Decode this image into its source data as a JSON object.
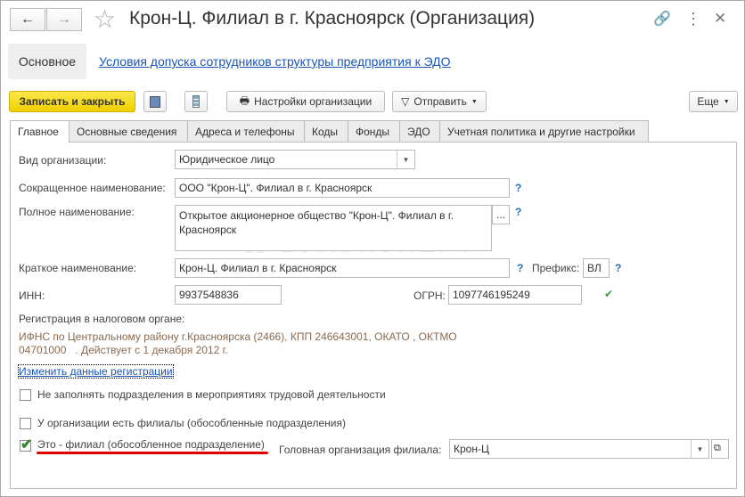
{
  "window": {
    "title": "Крон-Ц. Филиал в г. Красноярск (Организация)"
  },
  "nav": {
    "back": "←",
    "forward": "→",
    "star": "☆",
    "link": "🔗",
    "more": "⋮",
    "close": "✕"
  },
  "sections": {
    "main": "Основное",
    "link": "Условия допуска сотрудников структуры предприятия к ЭДО"
  },
  "toolbar": {
    "save_close": "Записать и закрыть",
    "settings": "Настройки организации",
    "send": "Отправить",
    "more": "Еще"
  },
  "tabs": [
    "Главное",
    "Основные сведения",
    "Адреса и телефоны",
    "Коды",
    "Фонды",
    "ЭДО",
    "Учетная политика и другие настройки"
  ],
  "form": {
    "org_type_label": "Вид организации:",
    "org_type": "Юридическое лицо",
    "short_name_label": "Сокращенное наименование:",
    "short_name": "ООО \"Крон-Ц\". Филиал в г. Красноярск",
    "full_name_label": "Полное наименование:",
    "full_name": "Открытое акционерное общество \"Крон-Ц\". Филиал в г. Красноярск",
    "brief_name_label": "Краткое наименование:",
    "brief_name": "Крон-Ц. Филиал в г. Красноярск",
    "prefix_label": "Префикс:",
    "prefix": "ВЛ",
    "inn_label": "ИНН:",
    "inn": "9937548836",
    "ogrn_label": "ОГРН:",
    "ogrn": "1097746195249",
    "reg_label": "Регистрация в налоговом органе:",
    "reg_line1": "ИФНС по Центральному району г.Красноярска (2466), КПП 246643001, ОКАТО , ОКТМО",
    "reg_line2": "04701000   . Действует с 1 декабря 2012 г.",
    "change_reg": "Изменить данные регистрации",
    "cb1": "Не заполнять подразделения в мероприятиях трудовой деятельности",
    "cb2": "У организации есть филиалы (обособленные подразделения)",
    "cb3": "Это - филиал (обособленное подразделение)",
    "head_org_label": "Головная организация филиала:",
    "head_org": "Крон-Ц",
    "q": "?",
    "ellipsis": "...",
    "ok": "✔"
  },
  "watermark": "БУХЭКСПЕРТ",
  "colors": {
    "accent": "#f5d90a",
    "link": "#1a55b4",
    "underline": "#e00000",
    "check": "#3a9a3a"
  }
}
